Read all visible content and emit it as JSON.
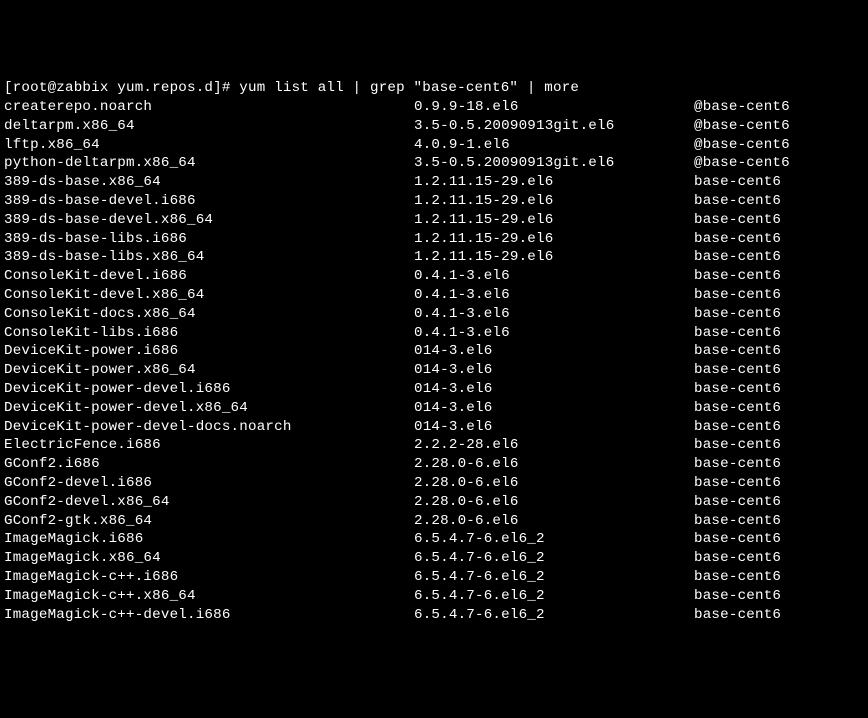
{
  "prompt": {
    "user_host": "[root@zabbix yum.repos.d]# ",
    "command": "yum list all | grep \"base-cent6\" | more"
  },
  "packages": [
    {
      "name": "createrepo.noarch",
      "version": "0.9.9-18.el6",
      "repo": "@base-cent6"
    },
    {
      "name": "deltarpm.x86_64",
      "version": "3.5-0.5.20090913git.el6",
      "repo": "@base-cent6"
    },
    {
      "name": "lftp.x86_64",
      "version": "4.0.9-1.el6",
      "repo": "@base-cent6"
    },
    {
      "name": "python-deltarpm.x86_64",
      "version": "3.5-0.5.20090913git.el6",
      "repo": "@base-cent6"
    },
    {
      "name": "389-ds-base.x86_64",
      "version": "1.2.11.15-29.el6",
      "repo": "base-cent6"
    },
    {
      "name": "389-ds-base-devel.i686",
      "version": "1.2.11.15-29.el6",
      "repo": "base-cent6"
    },
    {
      "name": "389-ds-base-devel.x86_64",
      "version": "1.2.11.15-29.el6",
      "repo": "base-cent6"
    },
    {
      "name": "389-ds-base-libs.i686",
      "version": "1.2.11.15-29.el6",
      "repo": "base-cent6"
    },
    {
      "name": "389-ds-base-libs.x86_64",
      "version": "1.2.11.15-29.el6",
      "repo": "base-cent6"
    },
    {
      "name": "ConsoleKit-devel.i686",
      "version": "0.4.1-3.el6",
      "repo": "base-cent6"
    },
    {
      "name": "ConsoleKit-devel.x86_64",
      "version": "0.4.1-3.el6",
      "repo": "base-cent6"
    },
    {
      "name": "ConsoleKit-docs.x86_64",
      "version": "0.4.1-3.el6",
      "repo": "base-cent6"
    },
    {
      "name": "ConsoleKit-libs.i686",
      "version": "0.4.1-3.el6",
      "repo": "base-cent6"
    },
    {
      "name": "DeviceKit-power.i686",
      "version": "014-3.el6",
      "repo": "base-cent6"
    },
    {
      "name": "DeviceKit-power.x86_64",
      "version": "014-3.el6",
      "repo": "base-cent6"
    },
    {
      "name": "DeviceKit-power-devel.i686",
      "version": "014-3.el6",
      "repo": "base-cent6"
    },
    {
      "name": "DeviceKit-power-devel.x86_64",
      "version": "014-3.el6",
      "repo": "base-cent6"
    },
    {
      "name": "DeviceKit-power-devel-docs.noarch",
      "version": "014-3.el6",
      "repo": "base-cent6"
    },
    {
      "name": "ElectricFence.i686",
      "version": "2.2.2-28.el6",
      "repo": "base-cent6"
    },
    {
      "name": "GConf2.i686",
      "version": "2.28.0-6.el6",
      "repo": "base-cent6"
    },
    {
      "name": "GConf2-devel.i686",
      "version": "2.28.0-6.el6",
      "repo": "base-cent6"
    },
    {
      "name": "GConf2-devel.x86_64",
      "version": "2.28.0-6.el6",
      "repo": "base-cent6"
    },
    {
      "name": "GConf2-gtk.x86_64",
      "version": "2.28.0-6.el6",
      "repo": "base-cent6"
    },
    {
      "name": "ImageMagick.i686",
      "version": "6.5.4.7-6.el6_2",
      "repo": "base-cent6"
    },
    {
      "name": "ImageMagick.x86_64",
      "version": "6.5.4.7-6.el6_2",
      "repo": "base-cent6"
    },
    {
      "name": "ImageMagick-c++.i686",
      "version": "6.5.4.7-6.el6_2",
      "repo": "base-cent6"
    },
    {
      "name": "ImageMagick-c++.x86_64",
      "version": "6.5.4.7-6.el6_2",
      "repo": "base-cent6"
    },
    {
      "name": "ImageMagick-c++-devel.i686",
      "version": "6.5.4.7-6.el6_2",
      "repo": "base-cent6"
    }
  ]
}
